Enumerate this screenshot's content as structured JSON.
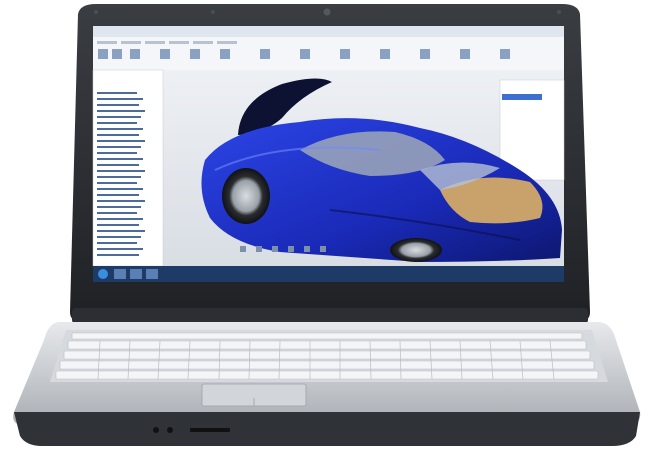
{
  "image": {
    "subject": "laptop-displaying-cad-software",
    "screen": {
      "title_bar": "",
      "ribbon_tabs": [],
      "model_tree_items": [],
      "viewport_caption": "",
      "taskbar_time": ""
    },
    "colors": {
      "laptop_bezel": "#2a2d31",
      "laptop_body": "#c9ccd0",
      "keyboard_keys": "#f2f3f5",
      "car_body": "#1b2fc8",
      "car_interior": "#c9a16a",
      "viewport_bg": "#e6e9ee",
      "taskbar": "#1e3a66"
    }
  }
}
